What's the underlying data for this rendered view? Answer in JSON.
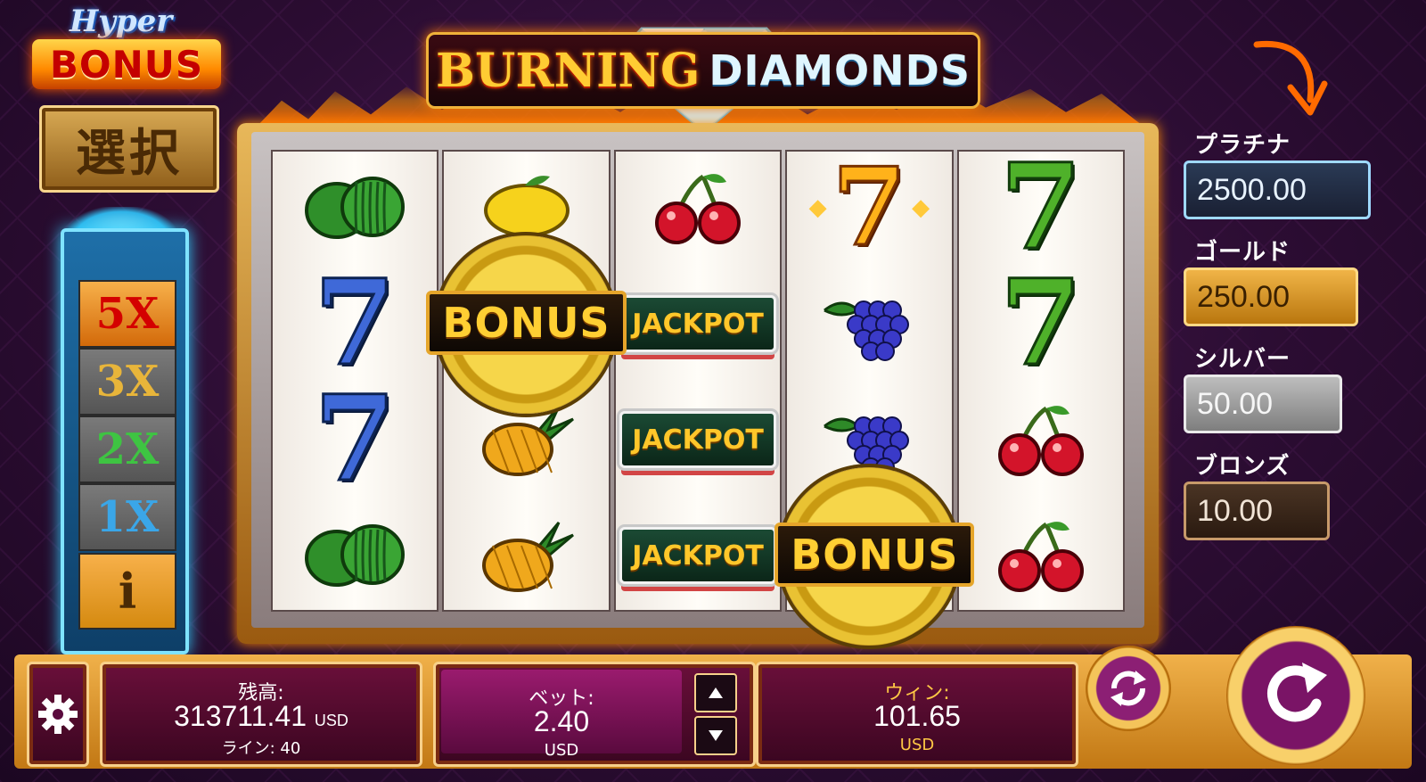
{
  "logo": {
    "line1": "Hyper",
    "line2": "BONUS"
  },
  "select_button": "選択",
  "multipliers": [
    "5X",
    "3X",
    "2X",
    "1X"
  ],
  "info_button": "i",
  "title": {
    "part1": "BURNING",
    "part2": "DIAMONDS"
  },
  "reels": [
    [
      "watermelon",
      "seven-blue",
      "seven-blue",
      "watermelon"
    ],
    [
      "lemon",
      "bonus",
      "pineapple",
      "pineapple"
    ],
    [
      "cherry",
      "jackpot",
      "jackpot",
      "jackpot"
    ],
    [
      "seven-gold",
      "grapes",
      "grapes",
      "bonus"
    ],
    [
      "seven-green",
      "seven-green",
      "cherry",
      "cherry"
    ]
  ],
  "symbols": {
    "bonus_label": "BONUS",
    "jackpot_label": "JACKPOT",
    "seven": "7"
  },
  "jackpot_tiers": [
    {
      "name": "プラチナ",
      "value": "2500.00"
    },
    {
      "name": "ゴールド",
      "value": "250.00"
    },
    {
      "name": "シルバー",
      "value": "50.00"
    },
    {
      "name": "ブロンズ",
      "value": "10.00"
    }
  ],
  "bottom": {
    "balance_label": "残高:",
    "balance_value": "313711.41",
    "balance_currency": "USD",
    "lines_label": "ライン: 40",
    "bet_label": "ベット:",
    "bet_value": "2.40",
    "bet_currency": "USD",
    "win_label": "ウィン:",
    "win_value": "101.65",
    "win_currency": "USD"
  },
  "colors": {
    "accent_gold": "#f0b14a",
    "panel": "#6a0f3a",
    "annotation_arrow": "#ff6a00"
  }
}
